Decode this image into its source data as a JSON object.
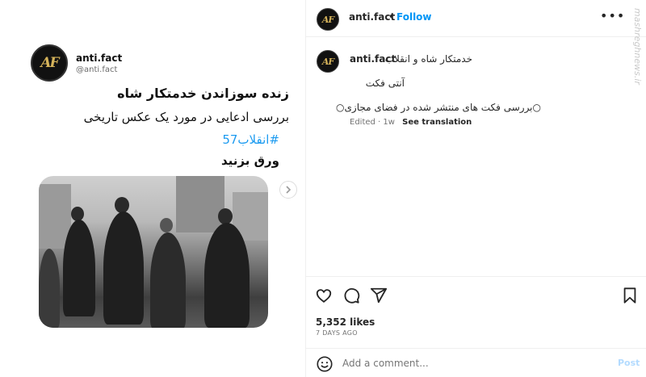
{
  "card": {
    "name": "anti.fact",
    "handle": "@anti.fact",
    "logo_text": "AF",
    "line1": "زنده سوزاندن خدمتکار شاه",
    "line2": "بررسی ادعایی در مورد یک عکس تاریخی",
    "hashtag": "#انقلاب57",
    "line4": "ورق بزنید"
  },
  "header": {
    "username": "anti.fact",
    "separator": "•",
    "follow_label": "Follow",
    "more": "•••"
  },
  "caption": {
    "username": "anti.fact",
    "title": "خدمتکار شاه و انقلاب",
    "line2": "آنتی فکت",
    "line3": "○بررسی فکت های منتشر شده در فضای مجازی○",
    "edited": "Edited · 1w",
    "see_translation": "See translation"
  },
  "watermark": "mashreghnews.ir",
  "stats": {
    "likes": "5,352 likes",
    "time": "7 DAYS AGO"
  },
  "comment": {
    "placeholder": "Add a comment...",
    "post_label": "Post"
  },
  "icons": {
    "like": "heart-icon",
    "comment": "comment-icon",
    "share": "share-icon",
    "save": "bookmark-icon",
    "emoji": "emoji-icon",
    "next": "chevron-right-icon"
  },
  "colors": {
    "accent": "#0095f6",
    "hashtag": "#1d9bf0",
    "muted": "#737373"
  }
}
